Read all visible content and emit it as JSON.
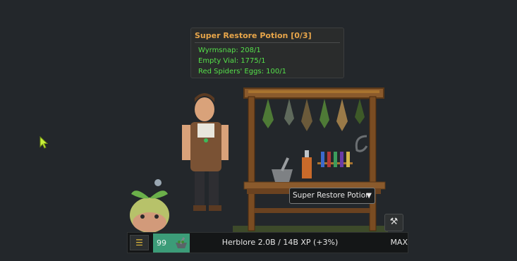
{
  "tooltip": {
    "title": "Super Restore Potion  [0/3]",
    "requirements": [
      "Wyrmsnap: 208/1",
      "Empty Vial: 1775/1",
      "Red Spiders' Eggs: 100/1"
    ]
  },
  "recipe_select": {
    "value": "Super Restore Potion"
  },
  "skill_bar": {
    "menu_icon": "menu-icon",
    "level": "99",
    "skill_icon": "mortar-pestle-icon",
    "xp_text": "Herblore  2.0B / 14B XP (+3%)",
    "max_label": "MAX"
  },
  "tool_button": {
    "icon": "hammer-pick-icon"
  },
  "colors": {
    "background": "#23272b",
    "tooltip_title": "#e8a64a",
    "requirement_met": "#55e04a",
    "level_box": "#3c9c78"
  }
}
